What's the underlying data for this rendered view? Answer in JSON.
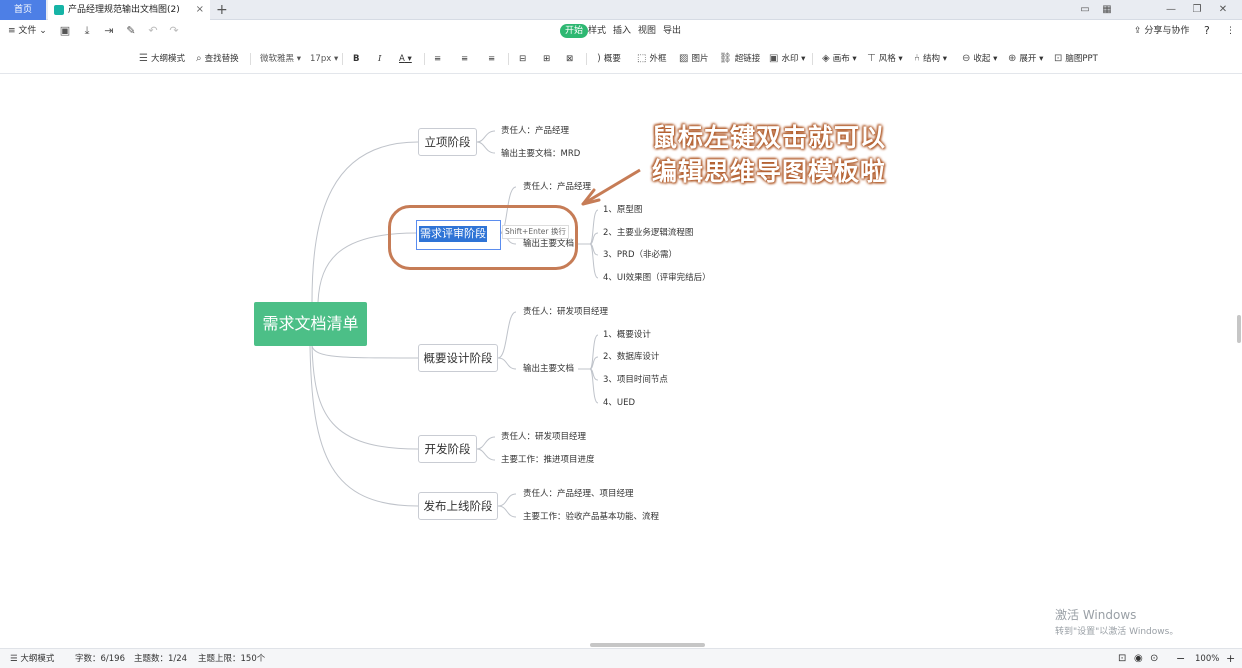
{
  "titlebar": {
    "home_tab": "首页",
    "doc_tab": "产品经理规范输出文档图(2)",
    "close": "×",
    "new_tab": "+"
  },
  "menubar": {
    "file": "文件",
    "tabs": [
      "开始",
      "样式",
      "插入",
      "视图",
      "导出"
    ],
    "share": "分享与协作",
    "help": "?"
  },
  "toolbar": {
    "outline_mode": "大纲模式",
    "find_replace": "查找替换",
    "font": "微软雅黑",
    "font_size": "17px",
    "bold": "B",
    "italic": "I",
    "color": "A",
    "summary": "概要",
    "frame": "外框",
    "image": "图片",
    "link": "超链接",
    "watermark": "水印",
    "canvas": "画布",
    "style": "风格",
    "structure": "结构",
    "collapse": "收起",
    "expand": "展开",
    "ppt": "脑图PPT"
  },
  "mindmap": {
    "root": "需求文档清单",
    "stage1": {
      "title": "立项阶段",
      "owner": "责任人：产品经理",
      "output": "输出主要文档：MRD"
    },
    "stage2": {
      "title": "需求评审阶段",
      "owner": "责任人：产品经理",
      "output": "输出主要文档",
      "items": [
        "1、原型图",
        "2、主要业务逻辑流程图",
        "3、PRD（非必需）",
        "4、UI效果图（评审完结后）"
      ],
      "hint": "Shift+Enter 换行"
    },
    "stage3": {
      "title": "概要设计阶段",
      "owner": "责任人：研发项目经理",
      "output": "输出主要文档",
      "items": [
        "1、概要设计",
        "2、数据库设计",
        "3、项目时间节点",
        "4、UED"
      ]
    },
    "stage4": {
      "title": "开发阶段",
      "owner": "责任人：研发项目经理",
      "work": "主要工作：推进项目进度"
    },
    "stage5": {
      "title": "发布上线阶段",
      "owner": "责任人：产品经理、项目经理",
      "work": "主要工作：验收产品基本功能、流程"
    }
  },
  "callout": {
    "line1": "鼠标左键双击就可以",
    "line2": "编辑思维导图模板啦"
  },
  "watermark": {
    "line1": "激活 Windows",
    "line2": "转到\"设置\"以激活 Windows。"
  },
  "statusbar": {
    "outline_mode": "大纲模式",
    "word_count": "字数：6/196",
    "topic_count": "主题数：1/24",
    "topic_limit": "主题上限：150个",
    "zoom_out": "−",
    "zoom": "100%",
    "zoom_in": "+"
  },
  "colors": {
    "root": "#4cbf87",
    "accent_tab": "#4d7fe6",
    "menu_active": "#2eb872",
    "annotation": "#c67c56",
    "selection": "#2f74d6"
  }
}
